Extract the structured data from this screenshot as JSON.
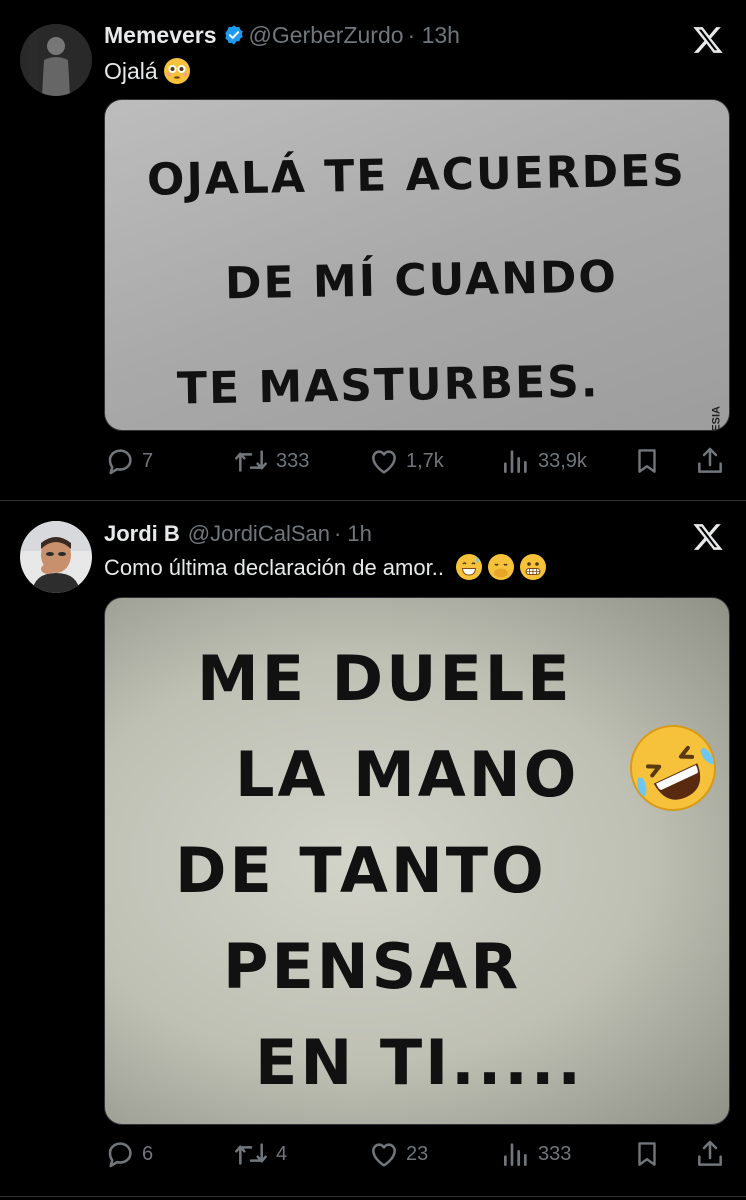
{
  "tweets": [
    {
      "name": "Memevers",
      "handle": "@GerberZurdo",
      "time": "· 13h",
      "text": "Ojalá",
      "emojis": [
        "flushed-face"
      ],
      "media_lines": [
        "OJALÁ TE ACUERDES",
        "DE MÍ CUANDO",
        "TE MASTURBES."
      ],
      "watermark": "ADEFESIA",
      "stats": {
        "replies": "7",
        "reposts": "333",
        "likes": "1,7k",
        "views": "33,9k"
      }
    },
    {
      "name": "Jordi B",
      "handle": "@JordiCalSan",
      "time": "· 1h",
      "text": "Como última declaración de amor..",
      "emojis": [
        "grinning-sweat-face",
        "face-with-hand-over-mouth",
        "grimacing-face"
      ],
      "media_lines": [
        "ME DUELE",
        "LA MANO",
        "DE TANTO",
        "PENSAR",
        "EN TI....."
      ],
      "media_emoji": "rolling-on-floor-laughing",
      "stats": {
        "replies": "6",
        "reposts": "4",
        "likes": "23",
        "views": "333"
      }
    }
  ],
  "colors": {
    "background": "#000000",
    "text": "#e7e9ea",
    "muted": "#71767b",
    "verified": "#1d9bf0",
    "divider": "#2f3336"
  }
}
